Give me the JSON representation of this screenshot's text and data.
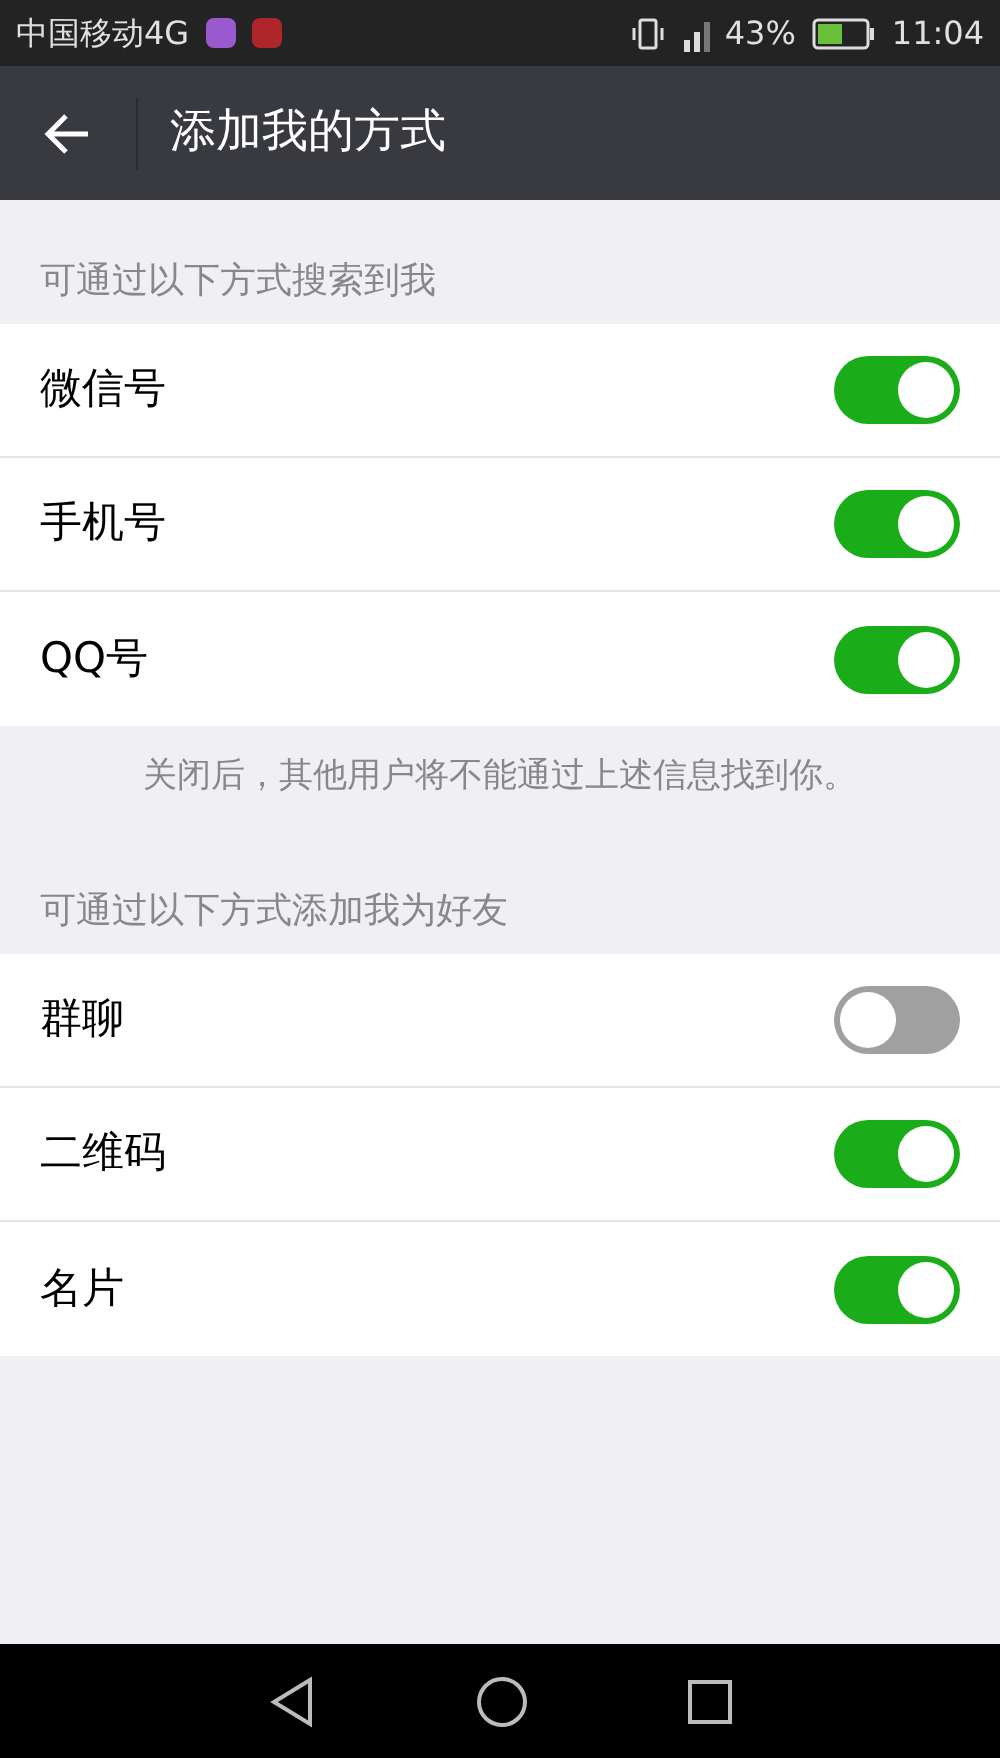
{
  "status_bar": {
    "carrier": "中国移动4G",
    "battery": "43%",
    "time": "11:04"
  },
  "header": {
    "title": "添加我的方式"
  },
  "sections": [
    {
      "title": "可通过以下方式搜索到我",
      "items": [
        {
          "label": "微信号",
          "on": true
        },
        {
          "label": "手机号",
          "on": true
        },
        {
          "label": "QQ号",
          "on": true
        }
      ],
      "note": "关闭后，其他用户将不能通过上述信息找到你。"
    },
    {
      "title": "可通过以下方式添加我为好友",
      "items": [
        {
          "label": "群聊",
          "on": false
        },
        {
          "label": "二维码",
          "on": true
        },
        {
          "label": "名片",
          "on": true
        }
      ]
    }
  ]
}
